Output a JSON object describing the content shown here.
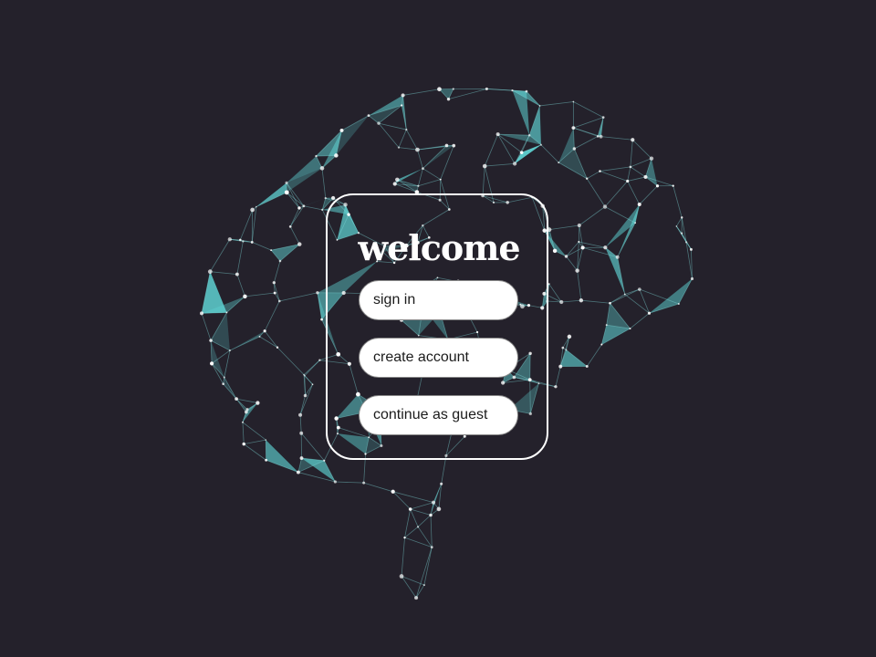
{
  "welcome": {
    "title": "welcome",
    "buttons": {
      "sign_in": "sign in",
      "create_account": "create account",
      "guest": "continue as guest"
    }
  },
  "background": {
    "image": "brain-network-graphic",
    "color": "#24212b",
    "accent": "#5fd3d3"
  }
}
